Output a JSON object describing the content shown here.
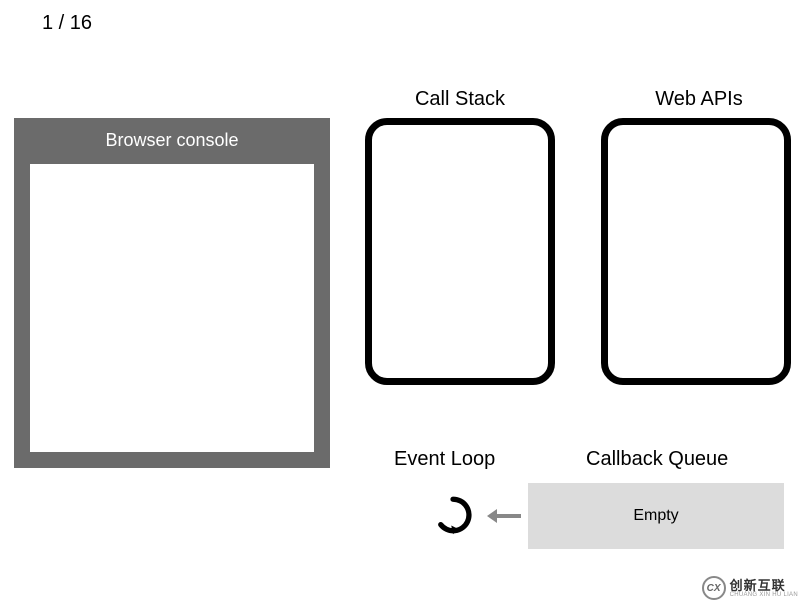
{
  "counter": {
    "current": 1,
    "total": 16,
    "display": "1 / 16"
  },
  "labels": {
    "callStack": "Call Stack",
    "webApis": "Web APIs",
    "browserConsole": "Browser console",
    "eventLoop": "Event Loop",
    "callbackQueue": "Callback Queue",
    "callbackQueueContent": "Empty"
  },
  "watermark": {
    "logo": "CX",
    "cn": "创新互联",
    "en": "CHUANG XIN HU LIAN"
  }
}
